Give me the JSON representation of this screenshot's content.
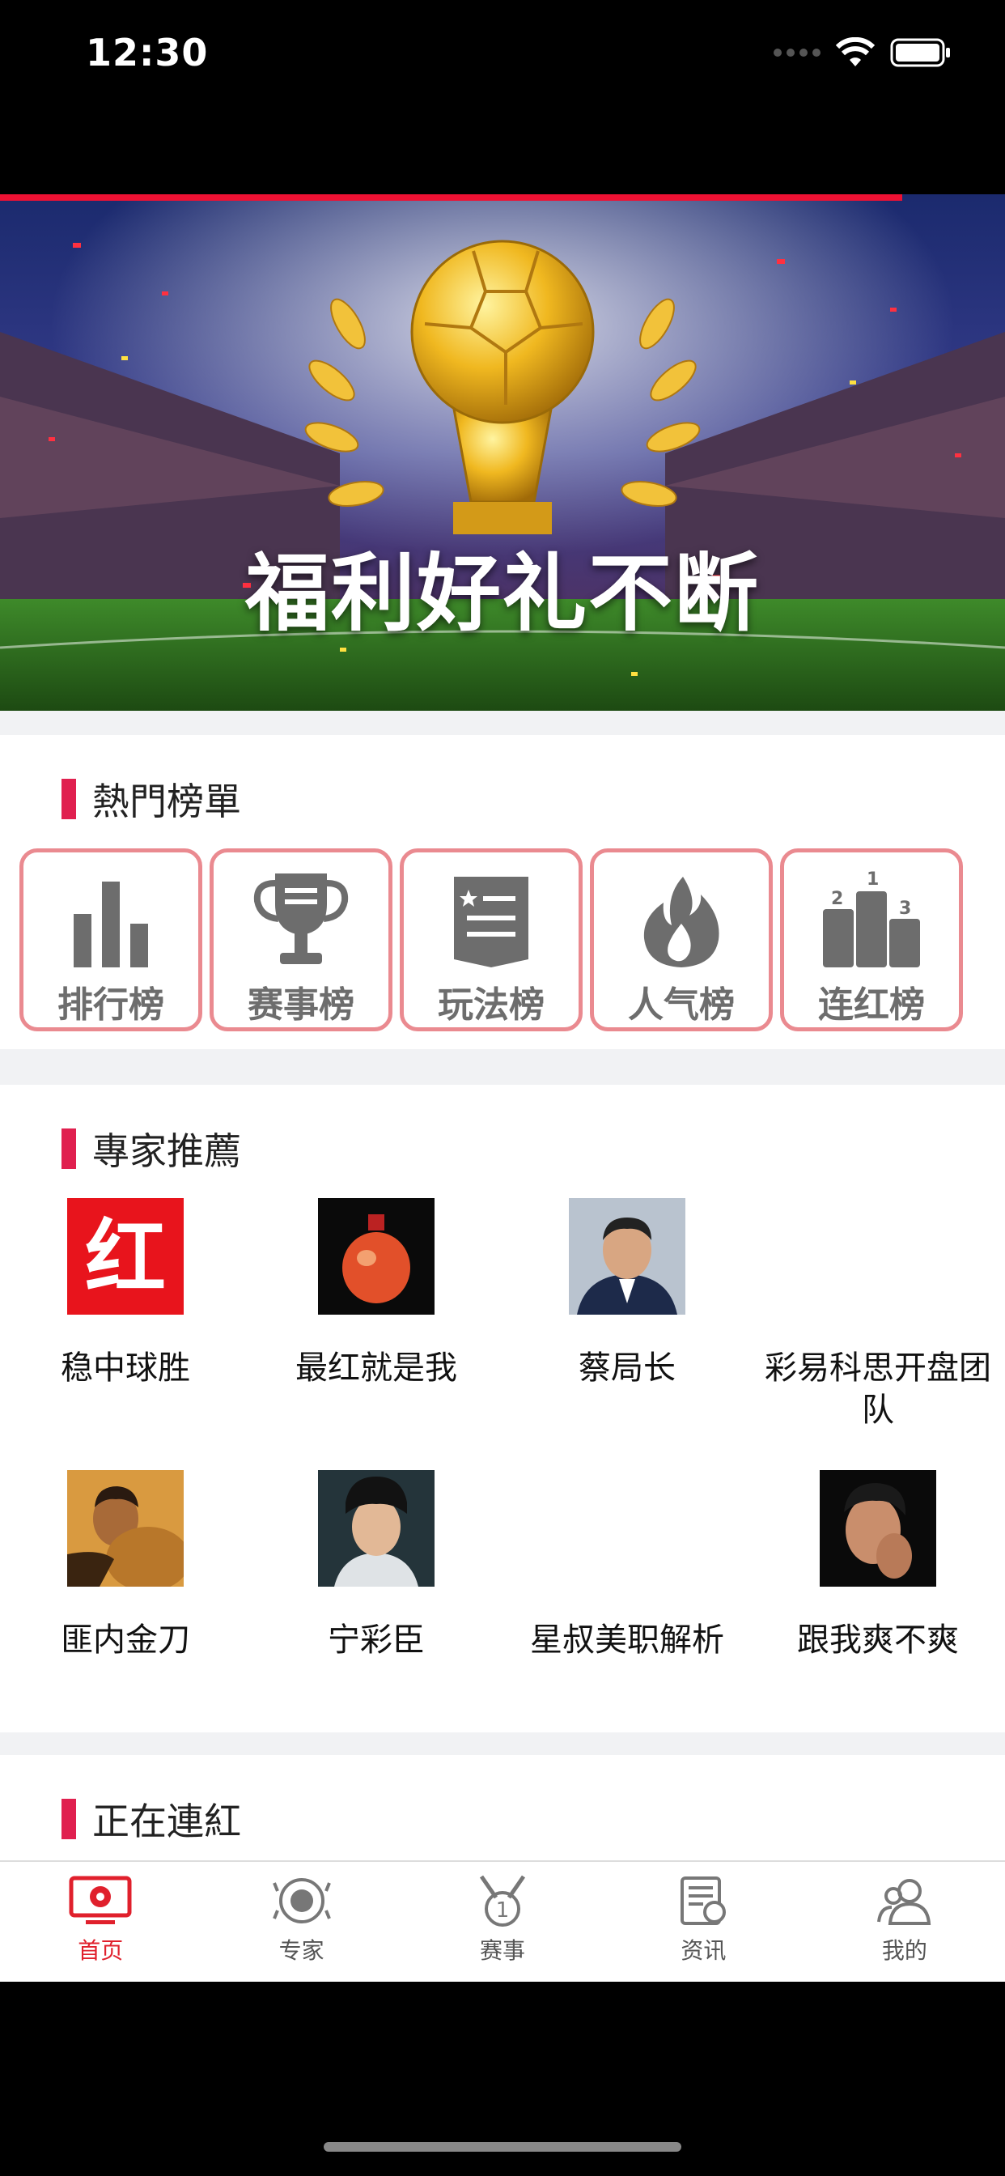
{
  "status": {
    "time": "12:30"
  },
  "banner": {
    "caption": "福利好礼不断"
  },
  "hot": {
    "title": "熱門榜單",
    "items": [
      {
        "label": "排行榜",
        "icon": "bar-chart-icon"
      },
      {
        "label": "赛事榜",
        "icon": "trophy-icon"
      },
      {
        "label": "玩法榜",
        "icon": "bookmark-list-icon"
      },
      {
        "label": "人气榜",
        "icon": "flame-icon"
      },
      {
        "label": "连红榜",
        "icon": "podium-icon"
      }
    ]
  },
  "experts": {
    "title": "專家推薦",
    "items": [
      {
        "name": "稳中球胜"
      },
      {
        "name": "最红就是我"
      },
      {
        "name": "蔡局长"
      },
      {
        "name": "彩易科思开盘团队"
      },
      {
        "name": "匪内金刀"
      },
      {
        "name": "宁彩臣"
      },
      {
        "name": "星叔美职解析"
      },
      {
        "name": "跟我爽不爽"
      }
    ]
  },
  "streak": {
    "title": "正在連紅"
  },
  "tabs": [
    {
      "label": "首页",
      "icon": "tv-ball-icon",
      "active": true
    },
    {
      "label": "专家",
      "icon": "expert-badge-icon",
      "active": false
    },
    {
      "label": "赛事",
      "icon": "medal-icon",
      "active": false
    },
    {
      "label": "资讯",
      "icon": "news-icon",
      "active": false
    },
    {
      "label": "我的",
      "icon": "user-icon",
      "active": false
    }
  ],
  "colors": {
    "accent": "#e0204f",
    "cardBorder": "#ea8a90",
    "tabActive": "#e0202c"
  }
}
